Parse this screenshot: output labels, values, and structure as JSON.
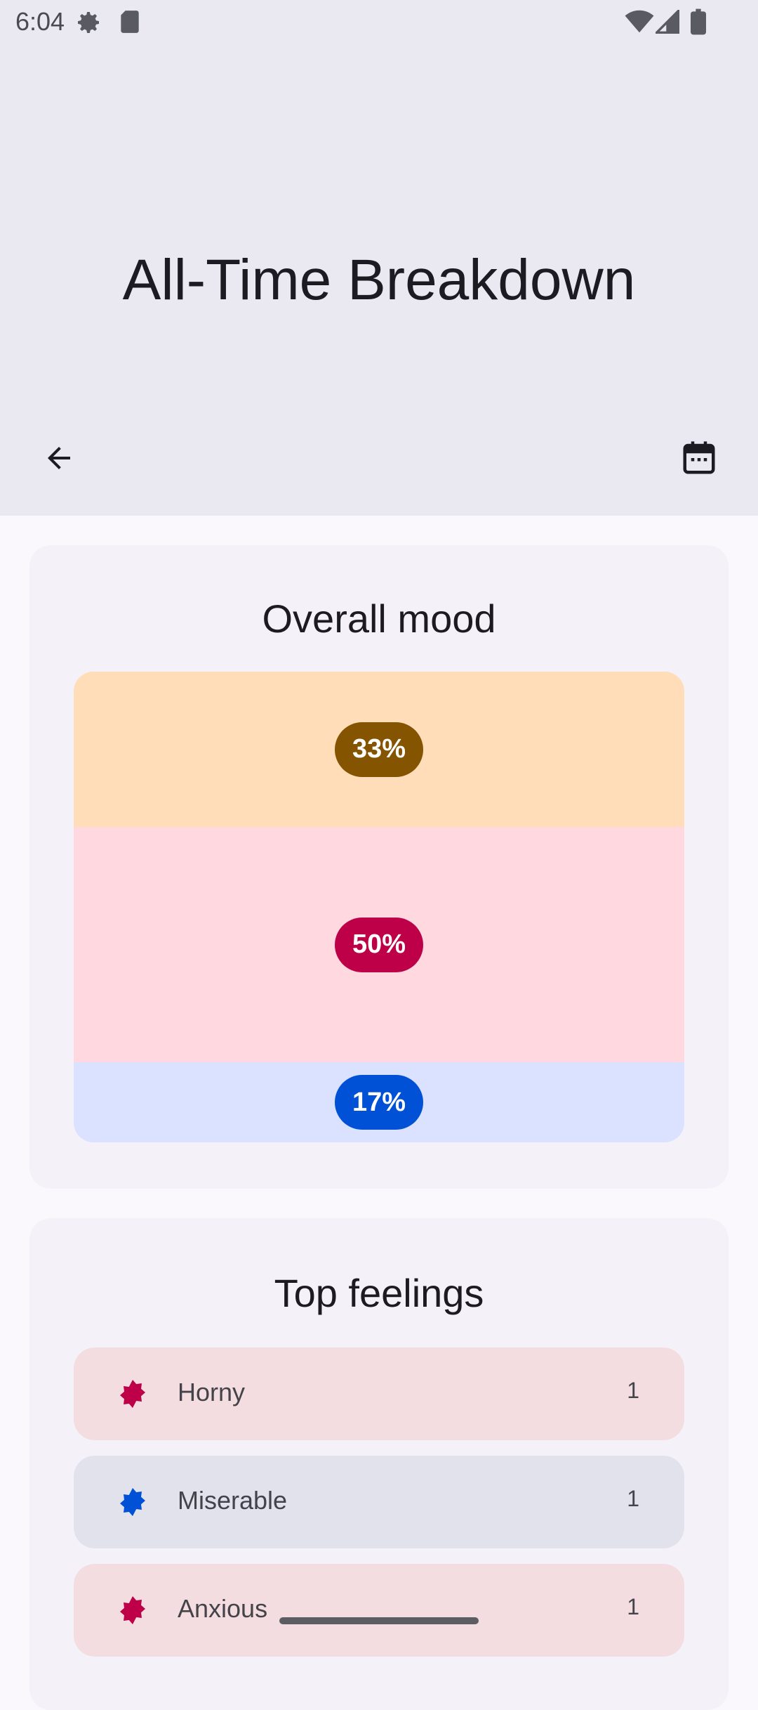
{
  "status_bar": {
    "time": "6:04",
    "left_icons": [
      "settings-icon",
      "sd-card-icon"
    ],
    "right_icons": [
      "wifi-icon",
      "signal-icon",
      "battery-icon"
    ]
  },
  "header": {
    "title": "All-Time Breakdown",
    "back_icon": "arrow-back-icon",
    "calendar_icon": "calendar-icon"
  },
  "overall_mood": {
    "title": "Overall mood",
    "segments": [
      {
        "label": "33%",
        "value": 33,
        "bg": "#FFDDB8",
        "pill": "#855400"
      },
      {
        "label": "50%",
        "value": 50,
        "bg": "#FFD9DF",
        "pill": "#BE0048"
      },
      {
        "label": "17%",
        "value": 17,
        "bg": "#DAE2FF",
        "pill": "#0051D6"
      }
    ]
  },
  "top_feelings": {
    "title": "Top feelings",
    "items": [
      {
        "name": "Horny",
        "count": "1",
        "bg": "#F3DDE0",
        "color": "#BE0048"
      },
      {
        "name": "Miserable",
        "count": "1",
        "bg": "#E2E2EC",
        "color": "#0051D6"
      },
      {
        "name": "Anxious",
        "count": "1",
        "bg": "#F3DDE0",
        "color": "#BE0048"
      }
    ]
  },
  "colors": {
    "header_bg": "#EAE8F1",
    "page_bg": "#FBF8FD",
    "card_bg": "#F4F2F8"
  }
}
